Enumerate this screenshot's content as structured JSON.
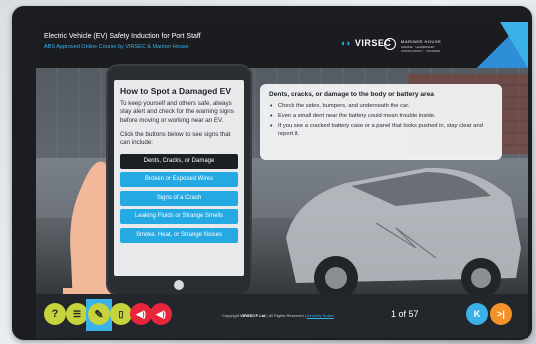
{
  "header": {
    "title": "Electric Vehicle (EV) Safety Induction for Port Staff",
    "subtitle": "ABS Approved Online Course by VIRSEC & Mariner House",
    "logo_virsec": "VIRSEC",
    "logo_mh_line1": "MARINER HOUSE",
    "logo_mh_line2": "MARINE · LEADERSHIP · CONSULTANCY · TRAINING"
  },
  "tablet": {
    "heading": "How to Spot a Damaged EV",
    "intro": "To keep yourself and others safe, always stay alert and check for the warning signs before moving or working near an EV.",
    "prompt": "Click the buttons below to see signs that can include:",
    "buttons": [
      "Dents, Cracks, or Damage",
      "Broken or Exposed Wires",
      "Signs of a Crash",
      "Leaking Fluids or Strange Smells",
      "Smoke, Heat, or Strange Noises"
    ],
    "active_index": 0
  },
  "info": {
    "heading": "Dents, cracks, or damage to the body or battery area",
    "bullets": [
      "Check the sides, bumpers, and underneath the car.",
      "Even a small dent near the battery could mean trouble inside.",
      "If you see a cracked battery case or a panel that looks pushed in, stay clear and report it."
    ]
  },
  "footer": {
    "help_label": "?",
    "copyright_prefix": "Copyright",
    "copyright_brand": "VIRSEC® Ltd",
    "copyright_suffix": "| All Rights Reserved |",
    "security_link": "Security Notice",
    "page_indicator": "1 of 57",
    "icons": [
      "help-icon",
      "menu-list-icon",
      "pencil-icon",
      "phone-icon",
      "audio-icon",
      "audio-icon",
      "back-icon",
      "next-icon"
    ]
  },
  "colors": {
    "accent_blue": "#3ab2e8",
    "accent_lime": "#c6d33c",
    "accent_red": "#e8253a",
    "accent_orange": "#f4922a",
    "active_button": "#1c1f23",
    "button_blue": "#25a9e3"
  }
}
